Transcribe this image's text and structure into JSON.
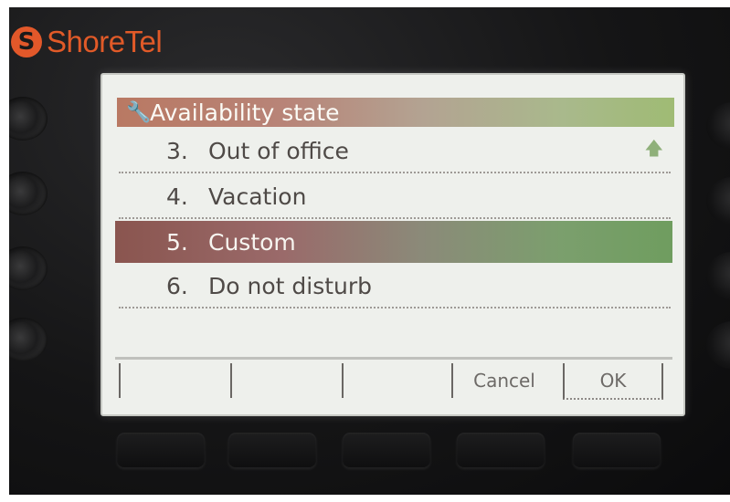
{
  "brand": {
    "name": "ShoreTel",
    "logo_glyph": "S",
    "color": "#e15a28"
  },
  "screen": {
    "title": "Availability state",
    "title_icon": "wrench-icon",
    "items": [
      {
        "num": "3.",
        "label": "Out of office"
      },
      {
        "num": "4.",
        "label": "Vacation"
      },
      {
        "num": "5.",
        "label": "Custom",
        "selected": true
      },
      {
        "num": "6.",
        "label": "Do not disturb"
      }
    ],
    "scroll_indicator": "up-arrow-icon",
    "softkeys": [
      "",
      "",
      "",
      "Cancel",
      "OK"
    ]
  }
}
